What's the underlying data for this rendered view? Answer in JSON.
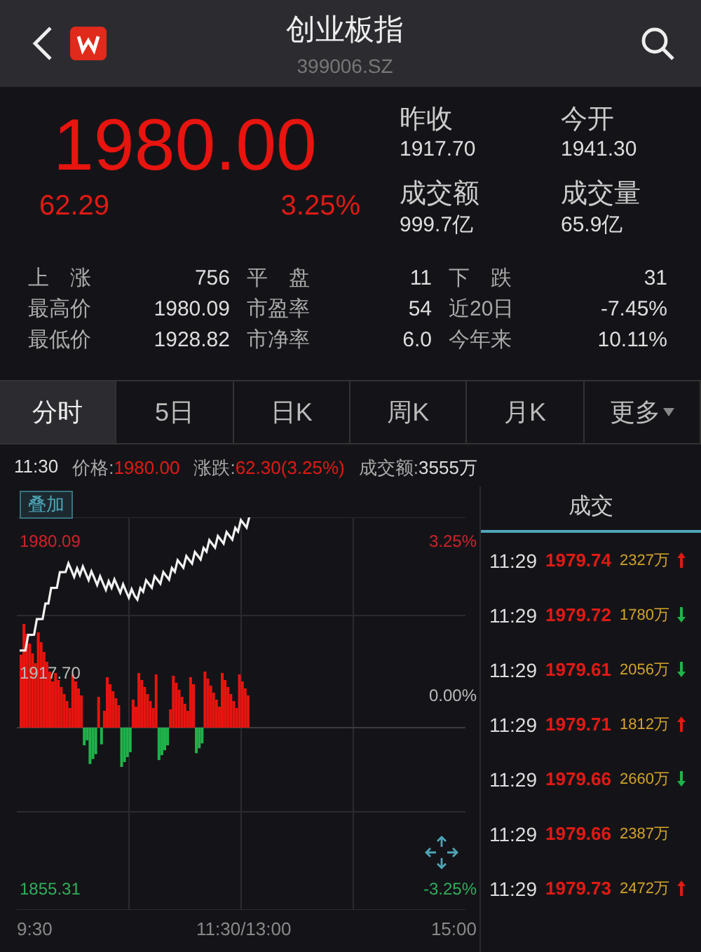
{
  "header": {
    "title": "创业板指",
    "code": "399006.SZ"
  },
  "quote": {
    "price": "1980.00",
    "change": "62.29",
    "percent": "3.25%"
  },
  "summary": [
    {
      "label": "昨收",
      "value": "1917.70"
    },
    {
      "label": "今开",
      "value": "1941.30"
    },
    {
      "label": "成交额",
      "value": "999.7亿"
    },
    {
      "label": "成交量",
      "value": "65.9亿"
    }
  ],
  "stats": [
    {
      "label": "上　涨",
      "value": "756"
    },
    {
      "label": "平　盘",
      "value": "11"
    },
    {
      "label": "下　跌",
      "value": "31"
    },
    {
      "label": "最高价",
      "value": "1980.09"
    },
    {
      "label": "市盈率",
      "value": "54"
    },
    {
      "label": "近20日",
      "value": "-7.45%"
    },
    {
      "label": "最低价",
      "value": "1928.82"
    },
    {
      "label": "市净率",
      "value": "6.0"
    },
    {
      "label": "今年来",
      "value": "10.11%"
    }
  ],
  "tabs": [
    {
      "label": "分时",
      "selected": true
    },
    {
      "label": "5日",
      "selected": false
    },
    {
      "label": "日K",
      "selected": false
    },
    {
      "label": "周K",
      "selected": false
    },
    {
      "label": "月K",
      "selected": false
    },
    {
      "label": "更多",
      "selected": false,
      "dropdown": true
    }
  ],
  "info": {
    "time": "11:30",
    "price_label": "价格:",
    "price": "1980.00",
    "change_label": "涨跌:",
    "change": "62.30(3.25%)",
    "amount_label": "成交额:",
    "amount": "3555万"
  },
  "chart": {
    "overlay_button": "叠加",
    "high": "1980.09",
    "base": "1917.70",
    "low": "1855.31",
    "pct_high": "3.25%",
    "pct_base": "0.00%",
    "pct_low": "-3.25%",
    "x_labels": [
      "9:30",
      "11:30/13:00",
      "15:00"
    ]
  },
  "trades": {
    "title": "成交",
    "rows": [
      {
        "time": "11:29",
        "price": "1979.74",
        "volume": "2327万",
        "kind": "up"
      },
      {
        "time": "11:29",
        "price": "1979.72",
        "volume": "1780万",
        "kind": "down"
      },
      {
        "time": "11:29",
        "price": "1979.61",
        "volume": "2056万",
        "kind": "down"
      },
      {
        "time": "11:29",
        "price": "1979.71",
        "volume": "1812万",
        "kind": "up"
      },
      {
        "time": "11:29",
        "price": "1979.66",
        "volume": "2660万",
        "kind": "down"
      },
      {
        "time": "11:29",
        "price": "1979.66",
        "volume": "2387万",
        "kind": "plain"
      },
      {
        "time": "11:29",
        "price": "1979.73",
        "volume": "2472万",
        "kind": "up"
      }
    ]
  }
}
